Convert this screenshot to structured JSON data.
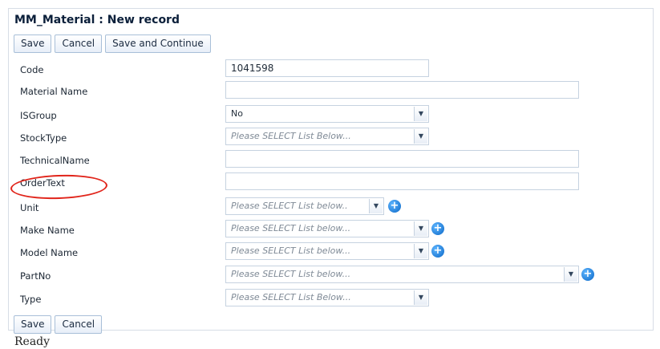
{
  "title": "MM_Material : New record",
  "toolbar": {
    "save": "Save",
    "cancel": "Cancel",
    "save_continue": "Save and Continue"
  },
  "fields": {
    "code": {
      "label": "Code",
      "value": "1041598"
    },
    "material_name": {
      "label": "Material Name",
      "value": ""
    },
    "isgroup": {
      "label": "ISGroup",
      "value": "No"
    },
    "stocktype": {
      "label": "StockType",
      "placeholder": "Please SELECT List Below..."
    },
    "technical_name": {
      "label": "TechnicalName",
      "value": ""
    },
    "order_text": {
      "label": "OrderText",
      "value": ""
    },
    "unit": {
      "label": "Unit",
      "placeholder": "Please SELECT List below.."
    },
    "make_name": {
      "label": "Make Name",
      "placeholder": "Please SELECT List below..."
    },
    "model_name": {
      "label": "Model Name",
      "placeholder": "Please SELECT List below..."
    },
    "partno": {
      "label": "PartNo",
      "placeholder": "Please SELECT List below..."
    },
    "type": {
      "label": "Type",
      "placeholder": "Please SELECT List Below..."
    }
  },
  "bottom_toolbar": {
    "save": "Save",
    "cancel": "Cancel"
  },
  "status": "Ready",
  "icons": {
    "dropdown": "chevron-down-icon",
    "add": "plus-circle-icon"
  },
  "annotation_color": "#e1251b"
}
